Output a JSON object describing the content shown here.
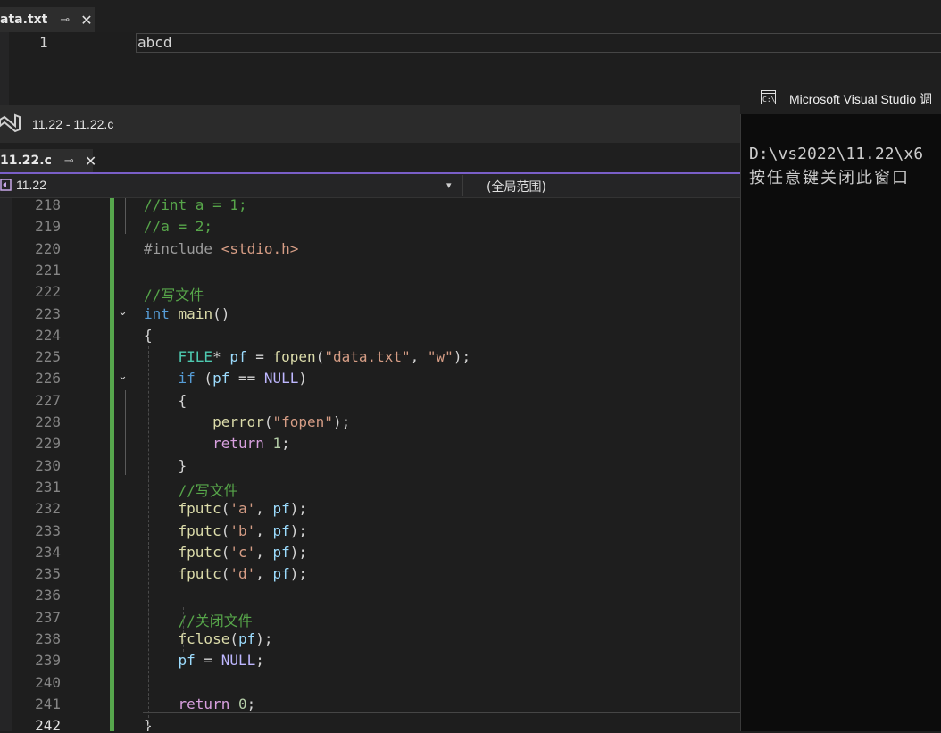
{
  "data_tab": {
    "label": "ata.txt",
    "pin": "⊸",
    "close": "✕"
  },
  "data_editor": {
    "line_number": "1",
    "content": "abcd"
  },
  "vs_window": {
    "title": "11.22 - 11.22.c"
  },
  "code_tab": {
    "label": "11.22.c",
    "pin": "⊸",
    "close": "✕"
  },
  "nav": {
    "project": "11.22",
    "dropdown": "▾",
    "scope": "(全局范围)"
  },
  "code_lines": [
    {
      "n": "218",
      "code": "//int a = 1;"
    },
    {
      "n": "219",
      "code": "//a = 2;"
    },
    {
      "n": "220",
      "code": "#include <stdio.h>"
    },
    {
      "n": "221",
      "code": ""
    },
    {
      "n": "222",
      "code": "//写文件"
    },
    {
      "n": "223",
      "code": "int main()"
    },
    {
      "n": "224",
      "code": "{"
    },
    {
      "n": "225",
      "code": "    FILE* pf = fopen(\"data.txt\", \"w\");"
    },
    {
      "n": "226",
      "code": "    if (pf == NULL)"
    },
    {
      "n": "227",
      "code": "    {"
    },
    {
      "n": "228",
      "code": "        perror(\"fopen\");"
    },
    {
      "n": "229",
      "code": "        return 1;"
    },
    {
      "n": "230",
      "code": "    }"
    },
    {
      "n": "231",
      "code": "    //写文件"
    },
    {
      "n": "232",
      "code": "    fputc('a', pf);"
    },
    {
      "n": "233",
      "code": "    fputc('b', pf);"
    },
    {
      "n": "234",
      "code": "    fputc('c', pf);"
    },
    {
      "n": "235",
      "code": "    fputc('d', pf);"
    },
    {
      "n": "236",
      "code": ""
    },
    {
      "n": "237",
      "code": "    //关闭文件"
    },
    {
      "n": "238",
      "code": "    fclose(pf);"
    },
    {
      "n": "239",
      "code": "    pf = NULL;"
    },
    {
      "n": "240",
      "code": ""
    },
    {
      "n": "241",
      "code": "    return 0;"
    },
    {
      "n": "242",
      "code": "}"
    }
  ],
  "fold_glyph": "⌄",
  "console": {
    "title": "Microsoft Visual Studio 调",
    "line1": "D:\\vs2022\\11.22\\x6",
    "line2": "按任意键关闭此窗口"
  },
  "colors": {
    "comment": "#57a64a",
    "keyword": "#569cd6",
    "green_bar": "#56a64c",
    "accent": "#7a5fc8"
  }
}
